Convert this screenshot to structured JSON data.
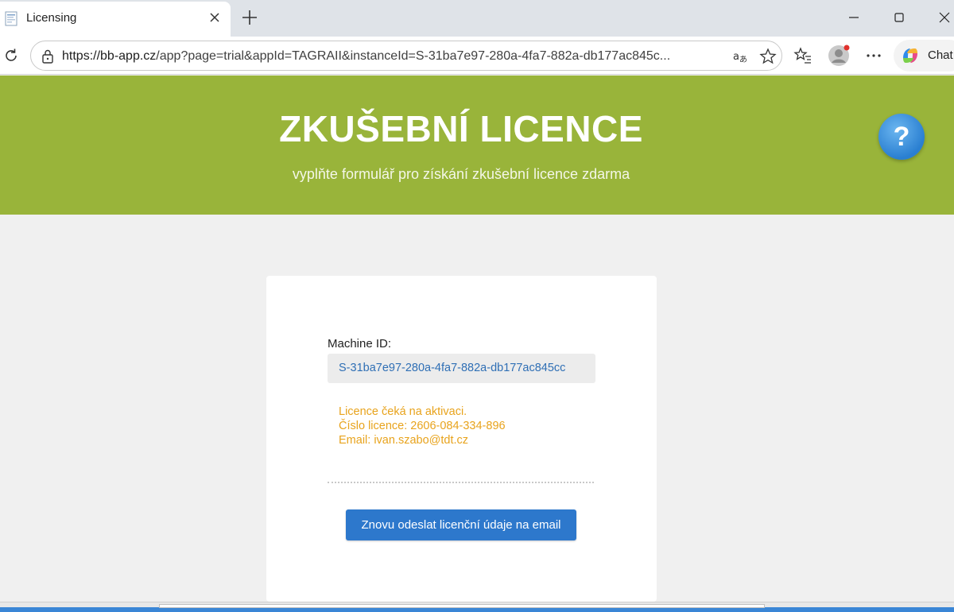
{
  "browser": {
    "tab_title": "Licensing",
    "url_host": "https://bb-app.cz",
    "url_rest": "/app?page=trial&appId=TAGRAII&instanceId=S-31ba7e97-280a-4fa7-882a-db177ac845c...",
    "chat_label": "Chat"
  },
  "hero": {
    "title": "ZKUŠEBNÍ LICENCE",
    "subtitle": "vyplňte formulář pro získání zkušební licence zdarma",
    "help_symbol": "?"
  },
  "card": {
    "machine_id_label": "Machine ID:",
    "machine_id_value": "S-31ba7e97-280a-4fa7-882a-db177ac845cc",
    "status_line1": "Licence čeká na aktivaci.",
    "status_line2": "Číslo licence: 2606-084-334-896",
    "status_line3": "Email: ivan.szabo@tdt.cz",
    "resend_button": "Znovu odeslat licenční údaje na email"
  },
  "colors": {
    "hero_bg": "#99b43a",
    "button_bg": "#2d78cc",
    "status_text": "#e8a31c",
    "id_text": "#2f6fb5"
  }
}
